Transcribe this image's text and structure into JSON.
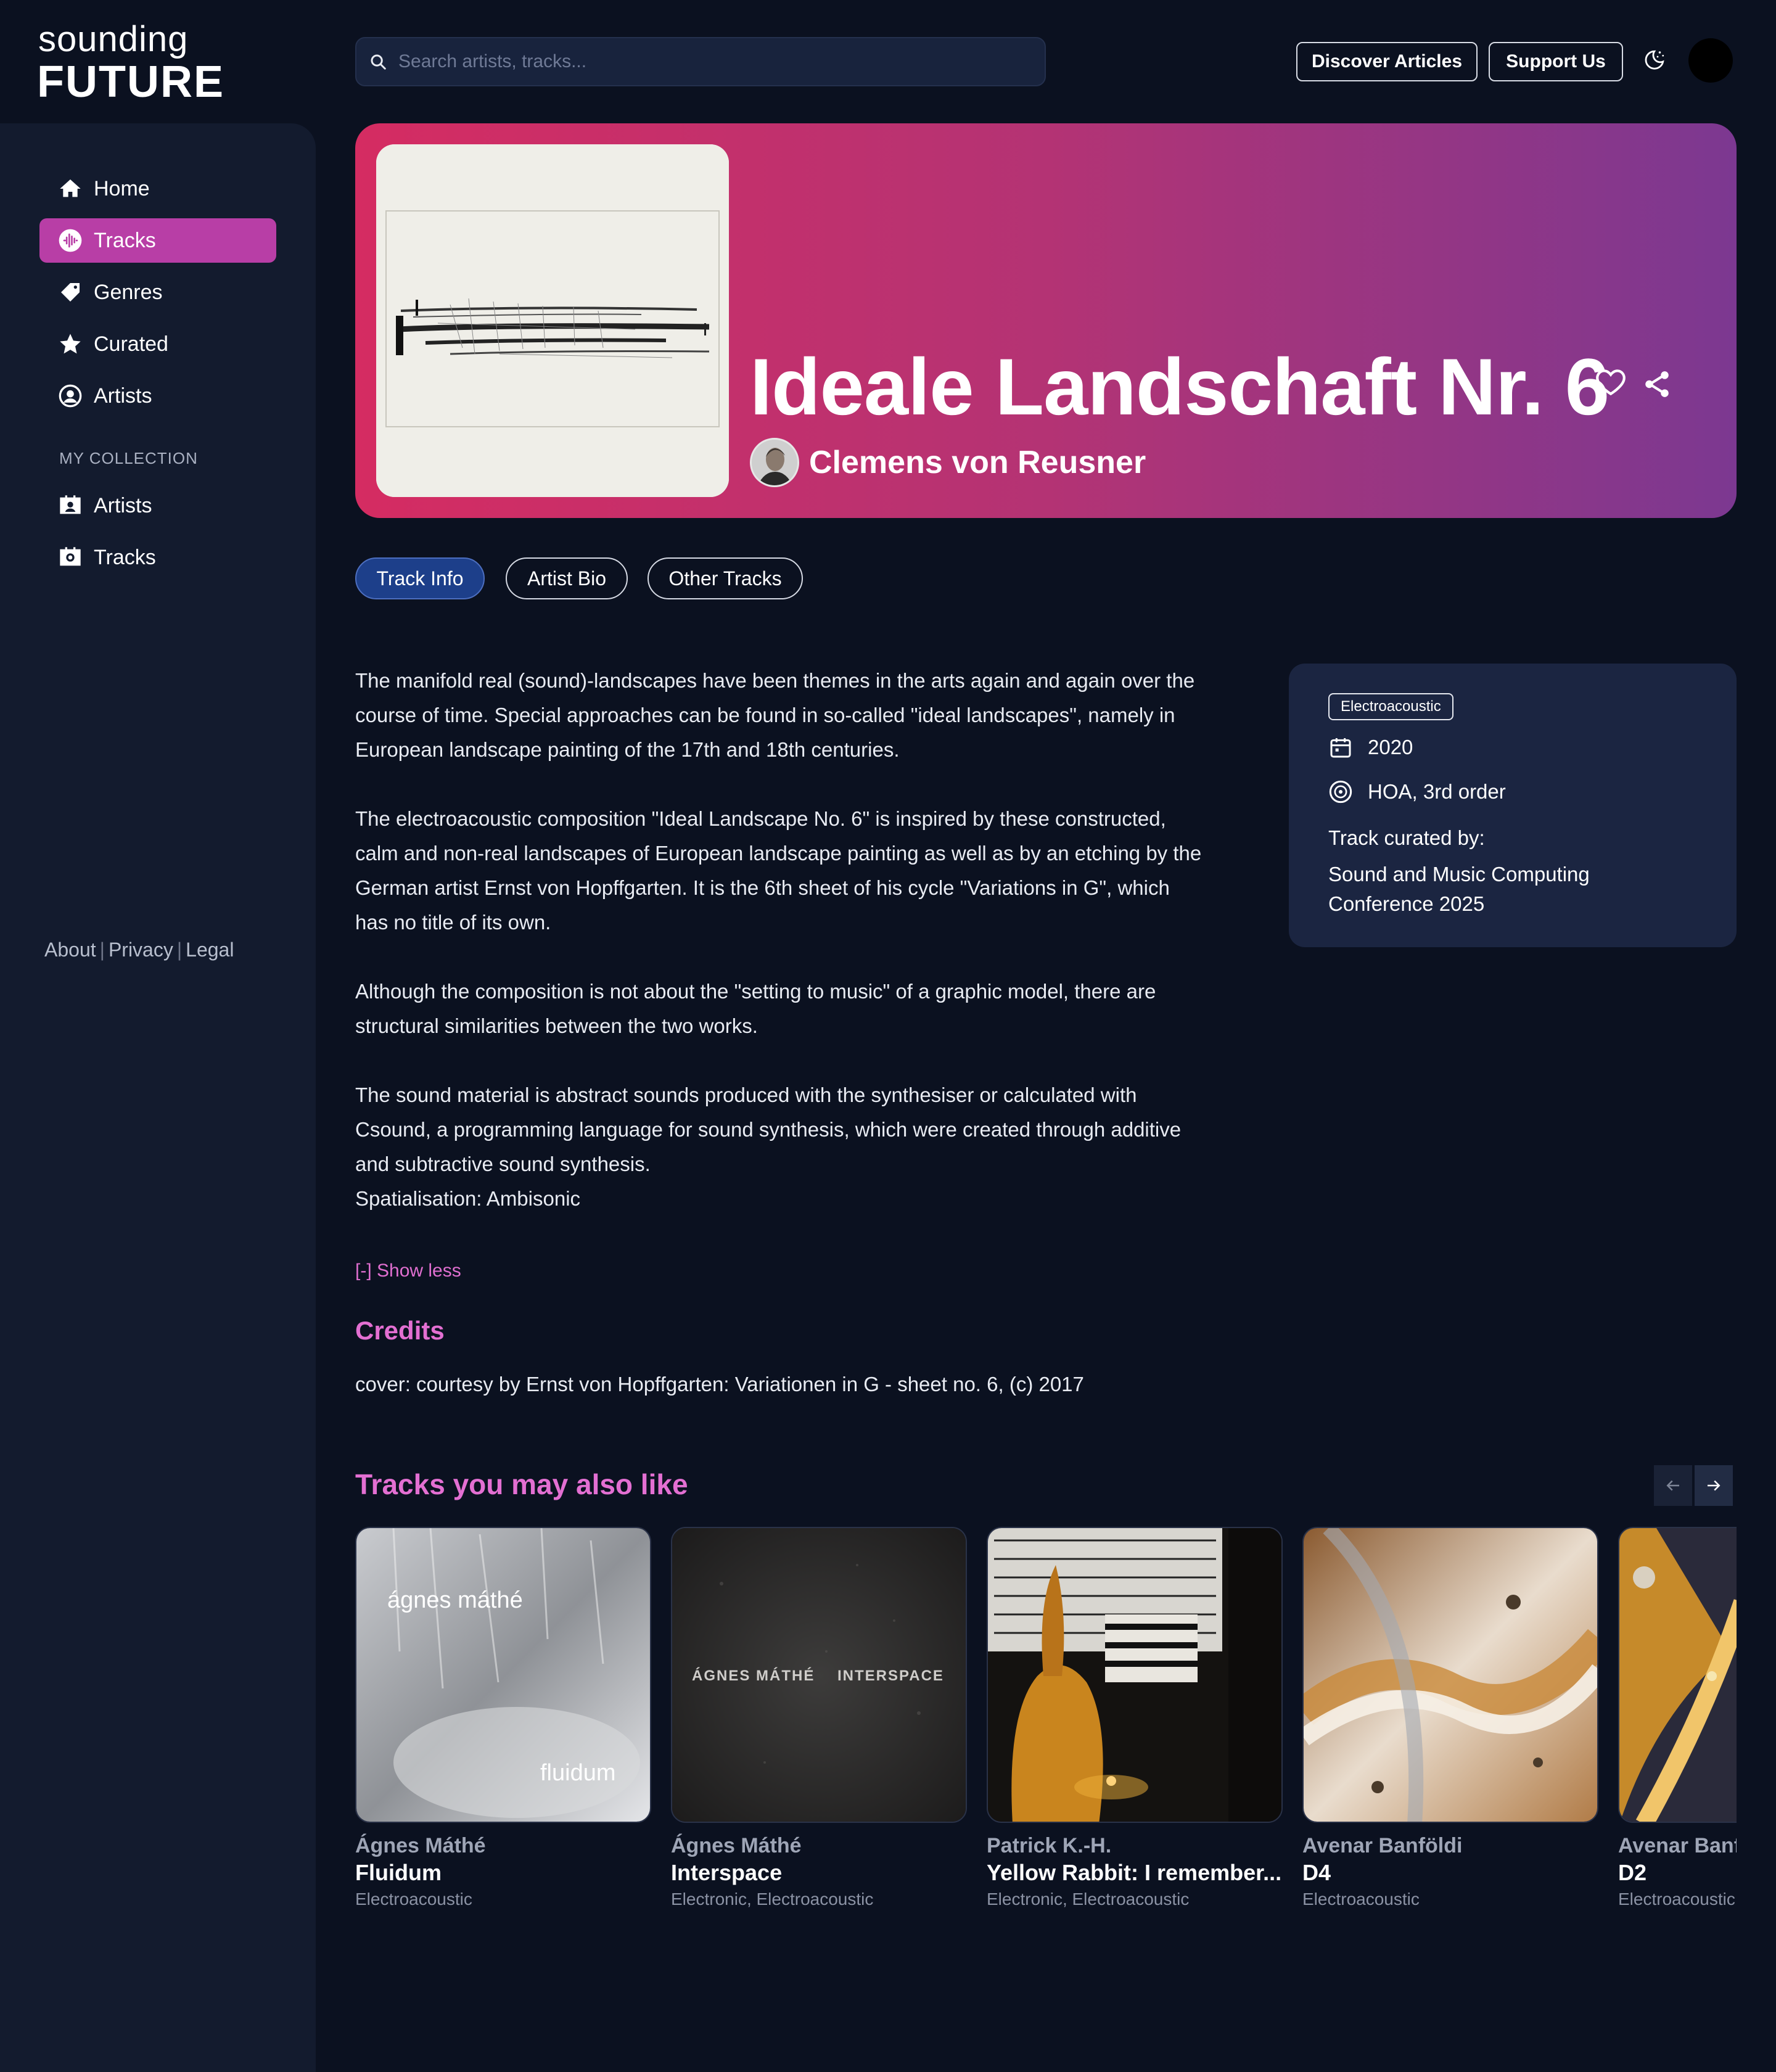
{
  "brand": {
    "logo_top": "sounding",
    "logo_bottom": "FUTURE"
  },
  "sidebar": {
    "nav": [
      {
        "label": "Home",
        "icon": "home-icon"
      },
      {
        "label": "Tracks",
        "icon": "waveform-icon",
        "active": true
      },
      {
        "label": "Genres",
        "icon": "tag-icon"
      },
      {
        "label": "Curated",
        "icon": "star-icon"
      },
      {
        "label": "Artists",
        "icon": "user-circle-icon"
      }
    ],
    "section_label": "MY COLLECTION",
    "collection": [
      {
        "label": "Artists",
        "icon": "contact-card-icon"
      },
      {
        "label": "Tracks",
        "icon": "camera-box-icon"
      }
    ],
    "footer": {
      "about": "About",
      "privacy": "Privacy",
      "legal": "Legal",
      "sep": "|"
    }
  },
  "header": {
    "search_placeholder": "Search artists, tracks...",
    "discover": "Discover Articles",
    "support": "Support Us"
  },
  "hero": {
    "title": "Ideale Landschaft Nr. 6",
    "artist": "Clemens von Reusner",
    "gradient": [
      "#d52c62",
      "#7c3891"
    ]
  },
  "tabs": [
    "Track Info",
    "Artist Bio",
    "Other Tracks"
  ],
  "description": {
    "p1": "The manifold real (sound)-landscapes have been themes in the arts again and again over the course of time. Special approaches can be found in so-called \"ideal landscapes\", namely in European landscape painting of the 17th and 18th centuries.",
    "p2": "The electroacoustic composition \"Ideal Landscape No. 6\" is inspired by these constructed, calm and non-real landscapes of European landscape painting as well as by an etching by the German artist Ernst von Hopffgarten. It is the 6th sheet of his cycle \"Variations in G\", which has no title of its own.",
    "p3": "Although the composition is not about the \"setting to music\" of a graphic model, there are structural similarities between the two works.",
    "p4": "The sound material is abstract sounds produced with the synthesiser or calculated with Csound, a programming language for sound synthesis, which were created through additive and subtractive sound synthesis.",
    "p5": "Spatialisation: Ambisonic",
    "show_less": "[-] Show less"
  },
  "credits": {
    "title": "Credits",
    "text": "cover: courtesy by Ernst von Hopffgarten: Variationen in G - sheet no. 6, (c) 2017"
  },
  "info": {
    "genre": "Electroacoustic",
    "year": "2020",
    "format": "HOA, 3rd order",
    "curated_label": "Track curated by:",
    "curated_by": "Sound and Music Computing Conference 2025"
  },
  "recommendations": {
    "title": "Tracks you may also like",
    "items": [
      {
        "artist": "Ágnes Máthé",
        "track": "Fluidum",
        "genre": "Electroacoustic",
        "cover_text_1": "ágnes máthé",
        "cover_text_2": "fluidum"
      },
      {
        "artist": "Ágnes Máthé",
        "track": "Interspace",
        "genre": "Electronic, Electroacoustic",
        "cover_text_1": "ÁGNES MÁTHÉ",
        "cover_text_2": "INTERSPACE"
      },
      {
        "artist": "Patrick K.-H.",
        "track": "Yellow Rabbit: I remember...",
        "genre": "Electronic, Electroacoustic"
      },
      {
        "artist": "Avenar Banföldi",
        "track": "D4",
        "genre": "Electroacoustic"
      },
      {
        "artist": "Avenar Banföldi",
        "track": "D2",
        "genre": "Electroacoustic"
      }
    ]
  },
  "colors": {
    "accent": "#b83ea6",
    "heading_pink": "#e36fd2",
    "bg": "#0b1120",
    "sidebar": "#131b2e",
    "card": "#1b2541"
  }
}
